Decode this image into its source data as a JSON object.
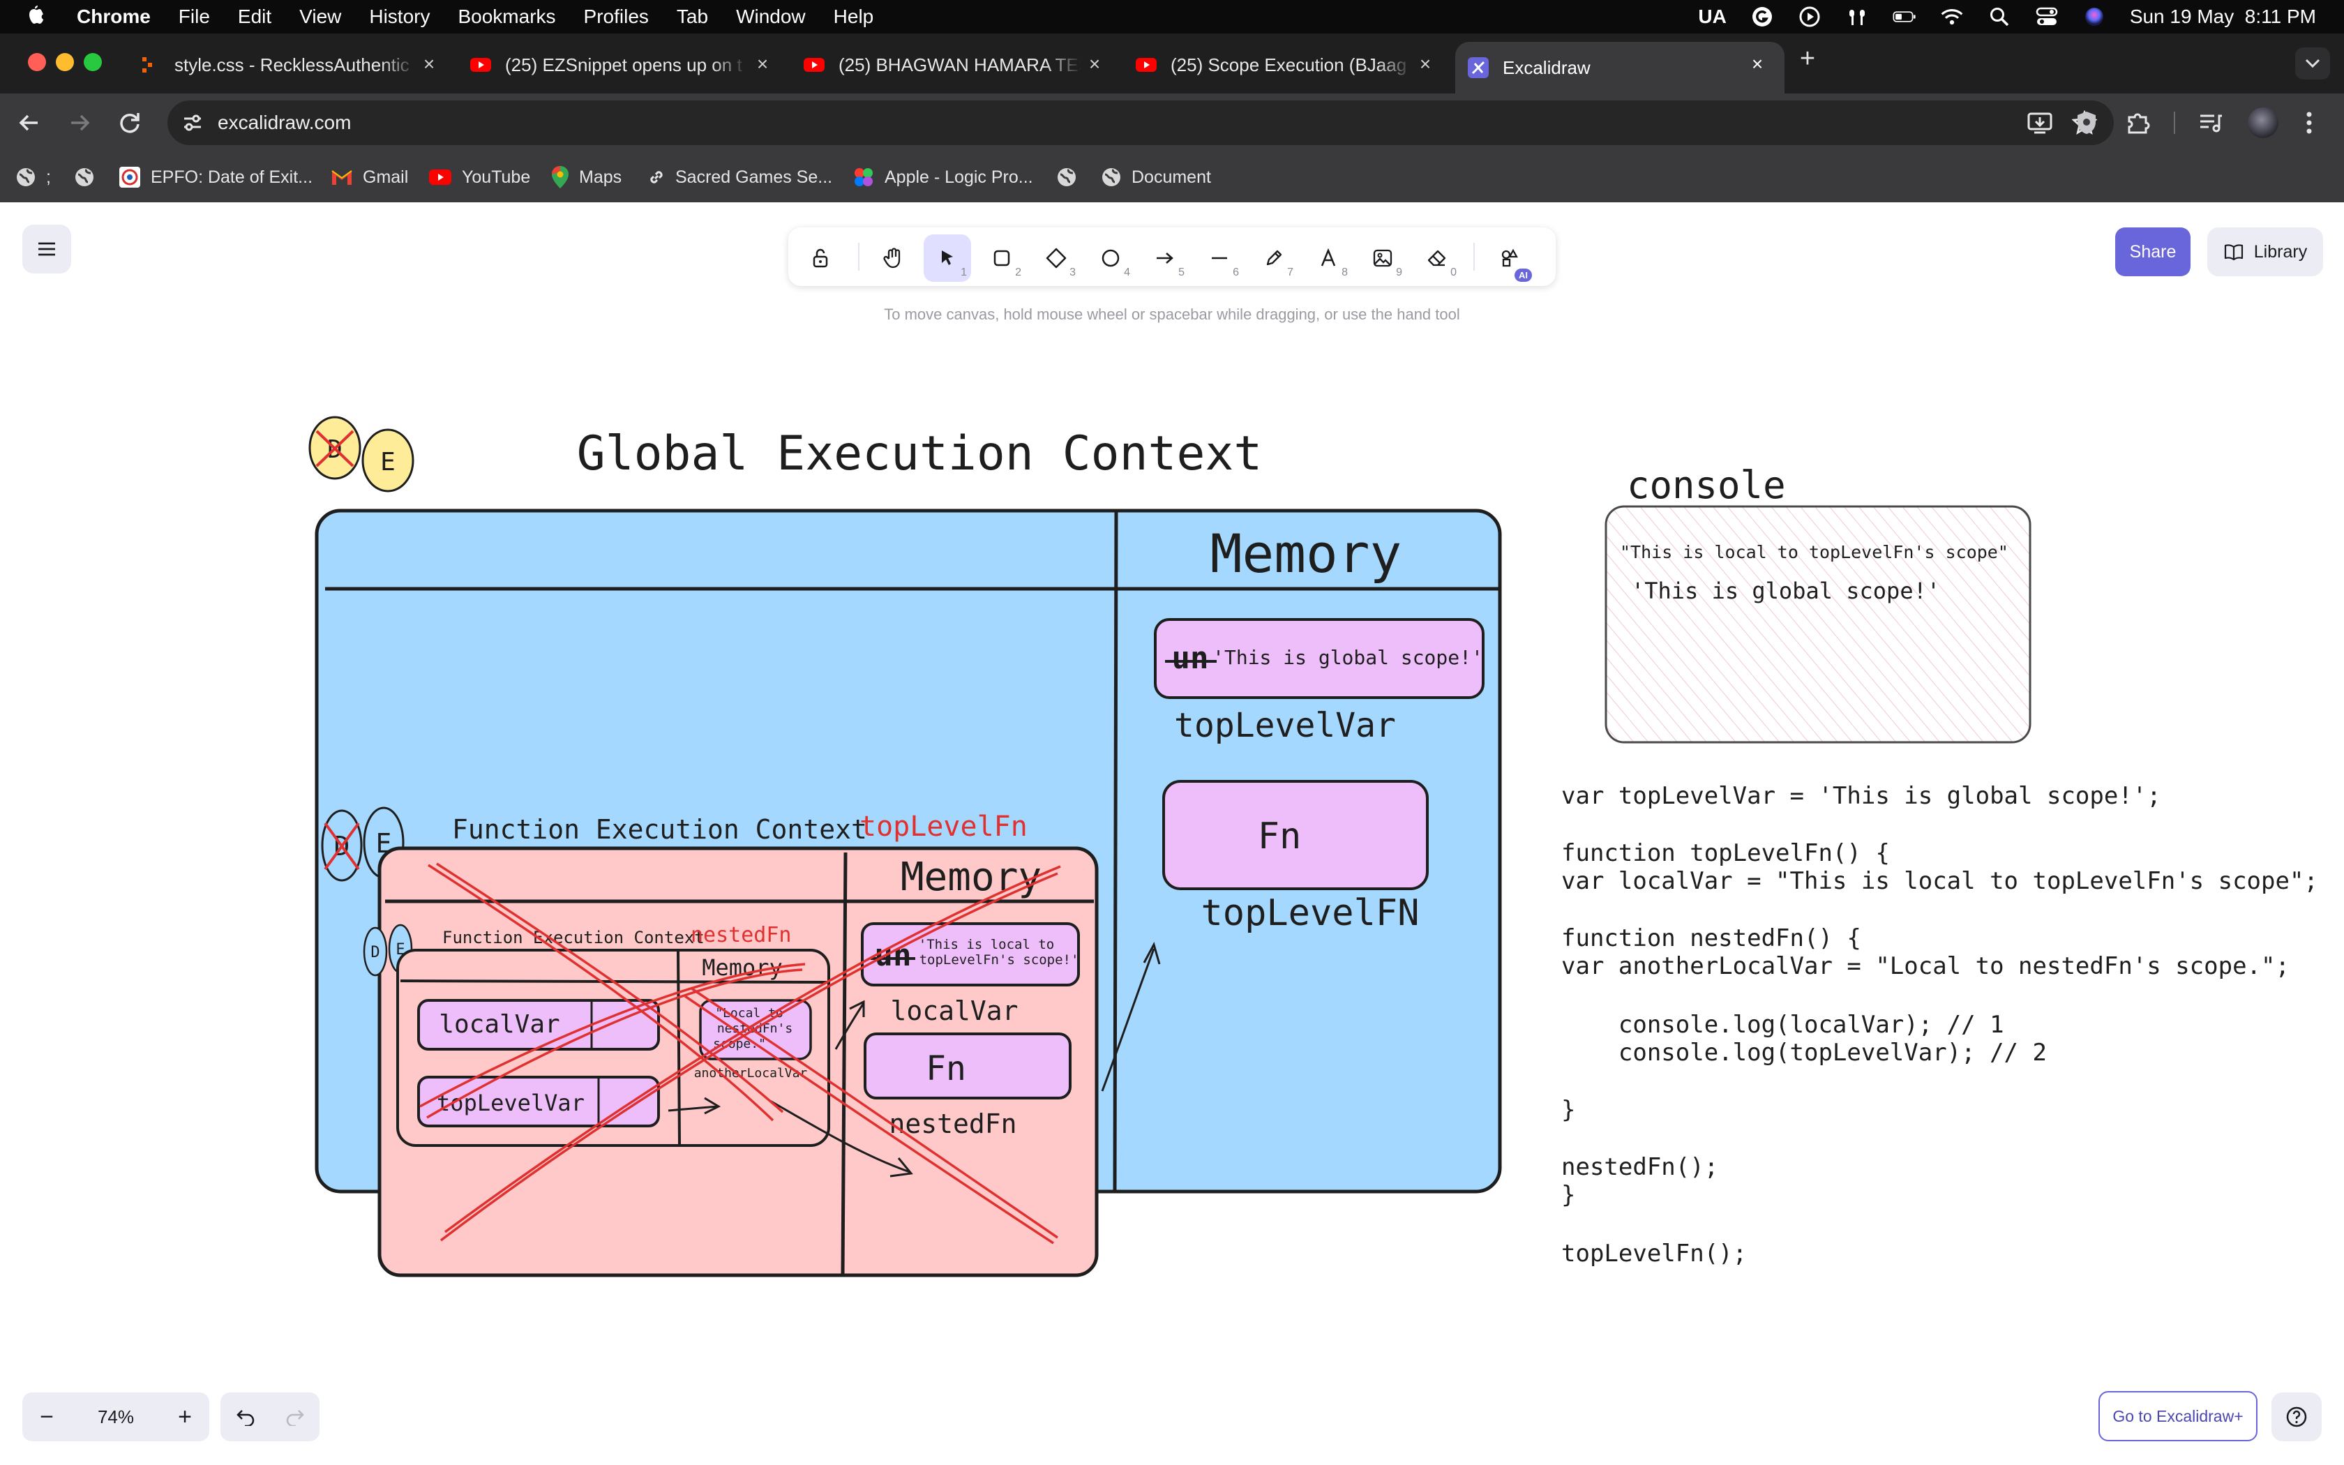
{
  "menubar": {
    "app": "Chrome",
    "items": [
      "File",
      "Edit",
      "View",
      "History",
      "Bookmarks",
      "Profiles",
      "Tab",
      "Window",
      "Help"
    ],
    "input_lang": "UA",
    "datetime": "Sun 19 May  8:11 PM"
  },
  "tabs": [
    {
      "title": "style.css - RecklessAuthentic",
      "favicon": "code-icon"
    },
    {
      "title": "(25) EZSnippet opens up on t",
      "favicon": "youtube-icon"
    },
    {
      "title": "(25) BHAGWAN HAMARA TES",
      "favicon": "youtube-icon"
    },
    {
      "title": "(25) Scope Execution (BJaag",
      "favicon": "youtube-icon"
    },
    {
      "title": "Excalidraw",
      "favicon": "excalidraw-icon",
      "active": true
    }
  ],
  "address": {
    "url": "excalidraw.com"
  },
  "bookmarks": [
    {
      "label": ";",
      "icon": "globe-icon"
    },
    {
      "label": "",
      "icon": "globe-icon"
    },
    {
      "label": "EPFO: Date of Exit...",
      "icon": "epfo-icon"
    },
    {
      "label": "Gmail",
      "icon": "gmail-icon"
    },
    {
      "label": "YouTube",
      "icon": "youtube-icon"
    },
    {
      "label": "Maps",
      "icon": "maps-icon"
    },
    {
      "label": "Sacred Games Se...",
      "icon": "link-icon"
    },
    {
      "label": "Apple - Logic Pro...",
      "icon": "apple-logic-icon"
    },
    {
      "label": "",
      "icon": "globe-icon"
    },
    {
      "label": "Document",
      "icon": "globe-icon"
    }
  ],
  "excalidraw": {
    "hint": "To move canvas, hold mouse wheel or spacebar while dragging, or use the hand tool",
    "share_label": "Share",
    "library_label": "Library",
    "zoom": "74%",
    "upsell_label": "Go to Excalidraw+",
    "tool_numbers": [
      "1",
      "2",
      "3",
      "4",
      "5",
      "6",
      "7",
      "8",
      "9",
      "0"
    ],
    "ai_badge": "AI"
  },
  "drawing": {
    "markers": {
      "d": "D",
      "e": "E"
    },
    "global_title": "Global Execution Context",
    "global_memory": "Memory",
    "global_mem_value_struck": "un",
    "global_mem_value": "'This is global scope!'",
    "global_mem_var": "topLevelVar",
    "global_fn_box": "Fn",
    "global_fn_name": "topLevelFN",
    "fec_title": "Function Execution Context",
    "fec_fn_name": "topLevelFn",
    "fec_memory": "Memory",
    "fec_mem_value_struck": "un",
    "fec_mem_value_line1": "'This is local to",
    "fec_mem_value_line2": "topLevelFn's scope!'",
    "fec_mem_var": "localVar",
    "fec_fn_box": "Fn",
    "fec_fn_name2": "nestedFn",
    "nec_title": "Function Execution Context",
    "nec_fn_name": "nestedFn",
    "nec_memory": "Memory",
    "nec_value_line1": "\"Local to",
    "nec_value_line2": "nestedFn's",
    "nec_value_line3": "scope.\"",
    "nec_var": "anotherLocalVar",
    "nec_code1": "localVar",
    "nec_code2": "topLevelVar",
    "console_title": "console",
    "console_lines": [
      "\"This is local to topLevelFn's scope\"",
      "'This is global scope!'"
    ],
    "code_lines": [
      "var topLevelVar = 'This is global scope!';",
      "",
      "function topLevelFn() {",
      "var localVar = \"This is local to topLevelFn's scope\";",
      "",
      "function nestedFn() {",
      "var anotherLocalVar = \"Local to nestedFn's scope.\";",
      "",
      "    console.log(localVar); // 1",
      "    console.log(topLevelVar); // 2",
      "",
      "}",
      "",
      "nestedFn();",
      "}",
      "",
      "topLevelFn();"
    ]
  },
  "colors": {
    "accent": "#6965db",
    "global_fill": "#a5d8ff",
    "fec_fill": "#ffc9c9",
    "box_fill": "#eebefa",
    "cross": "#e03131",
    "marker_yellow": "#ffec99"
  }
}
